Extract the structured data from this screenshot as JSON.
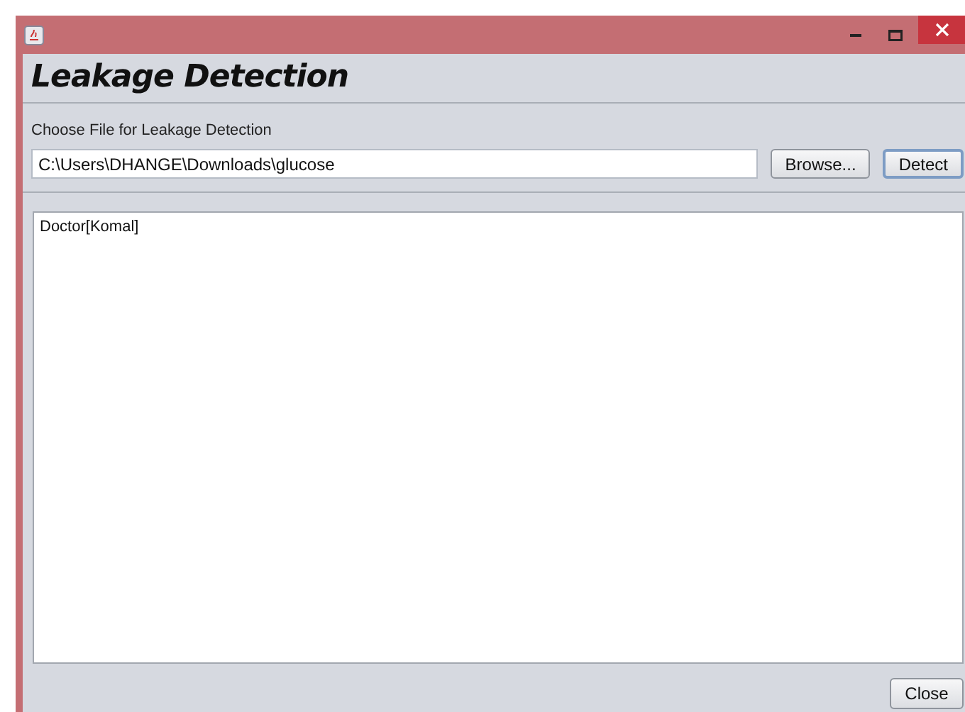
{
  "heading": "Leakage Detection",
  "file_label": "Choose File for Leakage Detection",
  "file_field": {
    "value": "C:\\Users\\DHANGE\\Downloads\\glucose"
  },
  "buttons": [
    {
      "label": "Browse...",
      "focused": false
    },
    {
      "label": "Detect",
      "focused": true
    }
  ],
  "output_text": "Doctor[Komal]",
  "close_button": {
    "label": "Close"
  }
}
